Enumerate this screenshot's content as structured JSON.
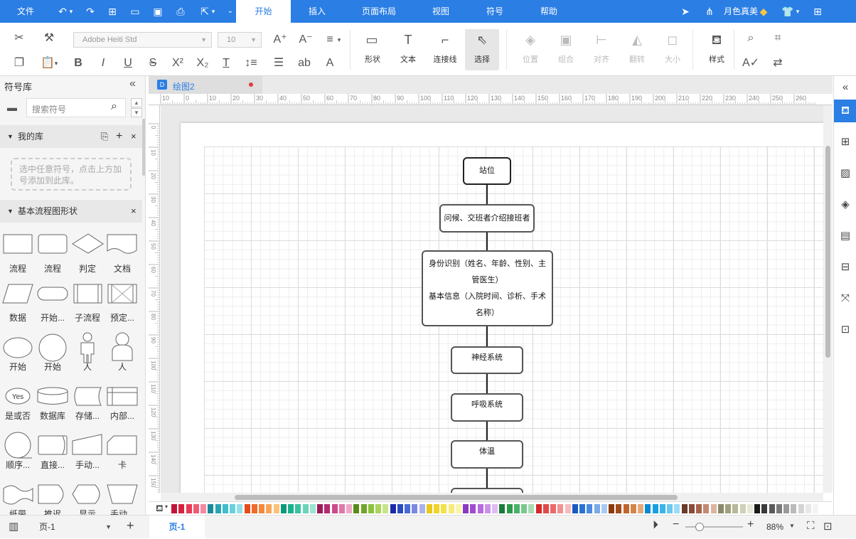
{
  "menu": {
    "file": "文件",
    "tabs": [
      "开始",
      "插入",
      "页面布局",
      "视图",
      "符号",
      "帮助"
    ],
    "active_tab": "开始",
    "user": "月色真美"
  },
  "ribbon": {
    "font_name": "Adobe Heiti Std",
    "font_size": "10",
    "shape_label": "形状",
    "text_label": "文本",
    "connector_label": "连接线",
    "select_label": "选择",
    "position_label": "位置",
    "group_label": "组合",
    "align_label": "对齐",
    "flip_label": "翻转",
    "size_label": "大小",
    "style_label": "样式"
  },
  "library": {
    "title": "符号库",
    "search_placeholder": "搜索符号",
    "my_library": "我的库",
    "my_library_hint": "选中任意符号，点击上方加号添加到此库。",
    "basic_flow": "基本流程图形状",
    "shapes": [
      "流程",
      "流程",
      "判定",
      "文档",
      "数据",
      "开始...",
      "子流程",
      "预定...",
      "开始",
      "开始",
      "人",
      "人",
      "是或否",
      "数据库",
      "存储...",
      "内部...",
      "顺序...",
      "直接...",
      "手动...",
      "卡",
      "纸带",
      "推迟",
      "显示",
      "手动..."
    ],
    "yes_label": "Yes"
  },
  "document": {
    "tab_name": "绘图2"
  },
  "ruler": {
    "h_ticks": [
      "10",
      "0",
      "10",
      "20",
      "30",
      "40",
      "50",
      "60",
      "70",
      "80",
      "90",
      "100",
      "110",
      "120",
      "130",
      "140",
      "150",
      "160",
      "170",
      "180",
      "190",
      "200",
      "210",
      "220",
      "230",
      "240",
      "250",
      "260"
    ],
    "v_ticks": [
      "0",
      "10",
      "20",
      "30",
      "40",
      "50",
      "60",
      "70",
      "80",
      "90",
      "100",
      "110",
      "120",
      "130",
      "140",
      "150"
    ]
  },
  "flowchart": {
    "n1": "站位",
    "n2": "问候、交班者介绍接班者",
    "n3a": "身份识别（姓名、年龄、性别、主",
    "n3b": "管医生）",
    "n3c": "基本信息（入院时间、诊析、手术",
    "n3d": "名称）",
    "n4": "神经系统",
    "n5": "呼吸系统",
    "n6": "体温"
  },
  "status": {
    "page_select": "页-1",
    "page_tab": "页-1",
    "zoom": "88%"
  },
  "palette": [
    "#c0143c",
    "#d6223f",
    "#e83a55",
    "#f05a72",
    "#f48aa0",
    "#1a8a9a",
    "#2aa5b5",
    "#44bccc",
    "#6ad0dc",
    "#95e0e8",
    "#e84a1a",
    "#f06a2a",
    "#f5883a",
    "#f8a55a",
    "#fbc07a",
    "#0a9a7a",
    "#1ab08a",
    "#3ac2a0",
    "#6ad4ba",
    "#9ae4d2",
    "#9a1a5a",
    "#b52a72",
    "#cc4a8a",
    "#e078aa",
    "#f0a8c8",
    "#5a8a1a",
    "#72a52a",
    "#8ac23a",
    "#a8d45a",
    "#c8e48a",
    "#1a2aa5",
    "#2a4ac0",
    "#4a6ad4",
    "#7a8ae0",
    "#a8b2ee",
    "#e8c81a",
    "#f0d42a",
    "#f5e04a",
    "#f8ea7a",
    "#fcf4aa",
    "#8a3ac0",
    "#a04ad0",
    "#b86ae0",
    "#cc92ea",
    "#e0bcf4",
    "#1a7a3a",
    "#2a9a4a",
    "#4ab26a",
    "#7ac88e",
    "#aadcb4",
    "#d42a2a",
    "#e04a4a",
    "#ea6a6a",
    "#f09292",
    "#f6bcbc",
    "#1a5ac0",
    "#2a72d4",
    "#4a8ae0",
    "#7aaaea",
    "#aacaf4",
    "#8a3a0a",
    "#a54a1a",
    "#c0642a",
    "#d4864a",
    "#e4aa7a",
    "#0a8ad4",
    "#1aa0e0",
    "#3ab4ea",
    "#6ac8f0",
    "#9adcf6",
    "#6a3a2a",
    "#8a4a3a",
    "#a8624a",
    "#c48a72",
    "#dcb4a0",
    "#8a8a6a",
    "#a0a080",
    "#b8b89a",
    "#d0d0b8",
    "#e8e8d8",
    "#1a1a1a",
    "#3a3a3a",
    "#5a5a5a",
    "#7a7a7a",
    "#9a9a9a",
    "#bababa",
    "#d4d4d4",
    "#e8e8e8",
    "#f4f4f4"
  ]
}
